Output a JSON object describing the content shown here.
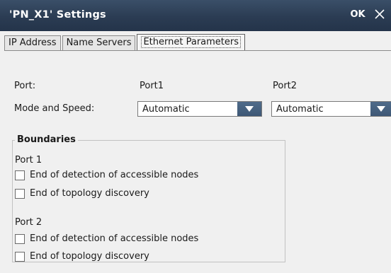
{
  "window": {
    "title": "'PN_X1' Settings",
    "ok_label": "OK"
  },
  "tabs": [
    {
      "label": "IP Address",
      "active": false
    },
    {
      "label": "Name Servers",
      "active": false
    },
    {
      "label": "Ethernet Parameters",
      "active": true
    }
  ],
  "form": {
    "port_label": "Port:",
    "port1_label": "Port1",
    "port2_label": "Port2",
    "mode_label": "Mode and Speed:",
    "port1_mode": "Automatic",
    "port2_mode": "Automatic"
  },
  "boundaries": {
    "title": "Boundaries",
    "port1": {
      "label": "Port 1",
      "options": [
        {
          "label": "End of detection of accessible nodes",
          "checked": false
        },
        {
          "label": "End of topology discovery",
          "checked": false
        }
      ]
    },
    "port2": {
      "label": "Port 2",
      "options": [
        {
          "label": "End of detection of accessible nodes",
          "checked": false
        },
        {
          "label": "End of topology discovery",
          "checked": false
        }
      ]
    }
  },
  "colors": {
    "titlebar": "#2b3c53",
    "dropdown_button": "#4a6583",
    "background": "#f0f0f0"
  }
}
